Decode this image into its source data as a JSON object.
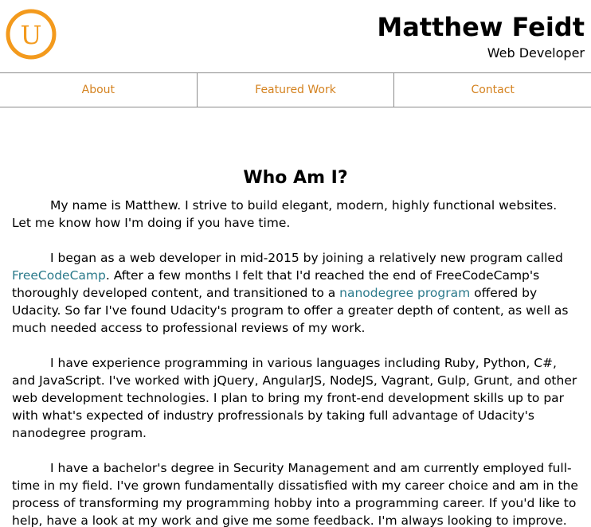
{
  "header": {
    "name": "Matthew Feidt",
    "title": "Web Developer",
    "logo_letter": "U",
    "logo_icon": "udacity-logo-icon"
  },
  "colors": {
    "accent": "#f39a1d",
    "nav_text": "#d4821f",
    "link": "#2b7a8b",
    "divider": "#8c8c8c"
  },
  "nav": {
    "items": [
      "About",
      "Featured Work",
      "Contact"
    ]
  },
  "about": {
    "title": "Who Am I?",
    "p1": "My name is Matthew. I strive to build elegant, modern, highly functional websites. Let me know how I'm doing if you have time.",
    "p2_a": "I began as a web developer in mid-2015 by joining a relatively new program called ",
    "p2_link1": "FreeCodeCamp",
    "p2_b": ". After a few months I felt that I'd reached the end of FreeCodeCamp's thoroughly developed content, and transitioned to a ",
    "p2_link2": "nanodegree program",
    "p2_c": " offered by Udacity. So far I've found Udacity's program to offer a greater depth of content, as well as much needed access to professional reviews of my work.",
    "p3": "I have experience programming in various languages including Ruby, Python, C#, and JavaScript. I've worked with jQuery, AngularJS, NodeJS, Vagrant, Gulp, Grunt, and other web development technologies. I plan to bring my front-end development skills up to par with what's expected of industry profressionals by taking full advantage of Udacity's nanodegree program.",
    "p4": "I have a bachelor's degree in Security Management and am currently employed full-time in my field. I've grown fundamentally dissatisfied with my career choice and am in the process of transforming my programming hobby into a programming career. If you'd like to help, have a look at my work and give me some feedback. I'm always looking to improve. Thanks for"
  }
}
